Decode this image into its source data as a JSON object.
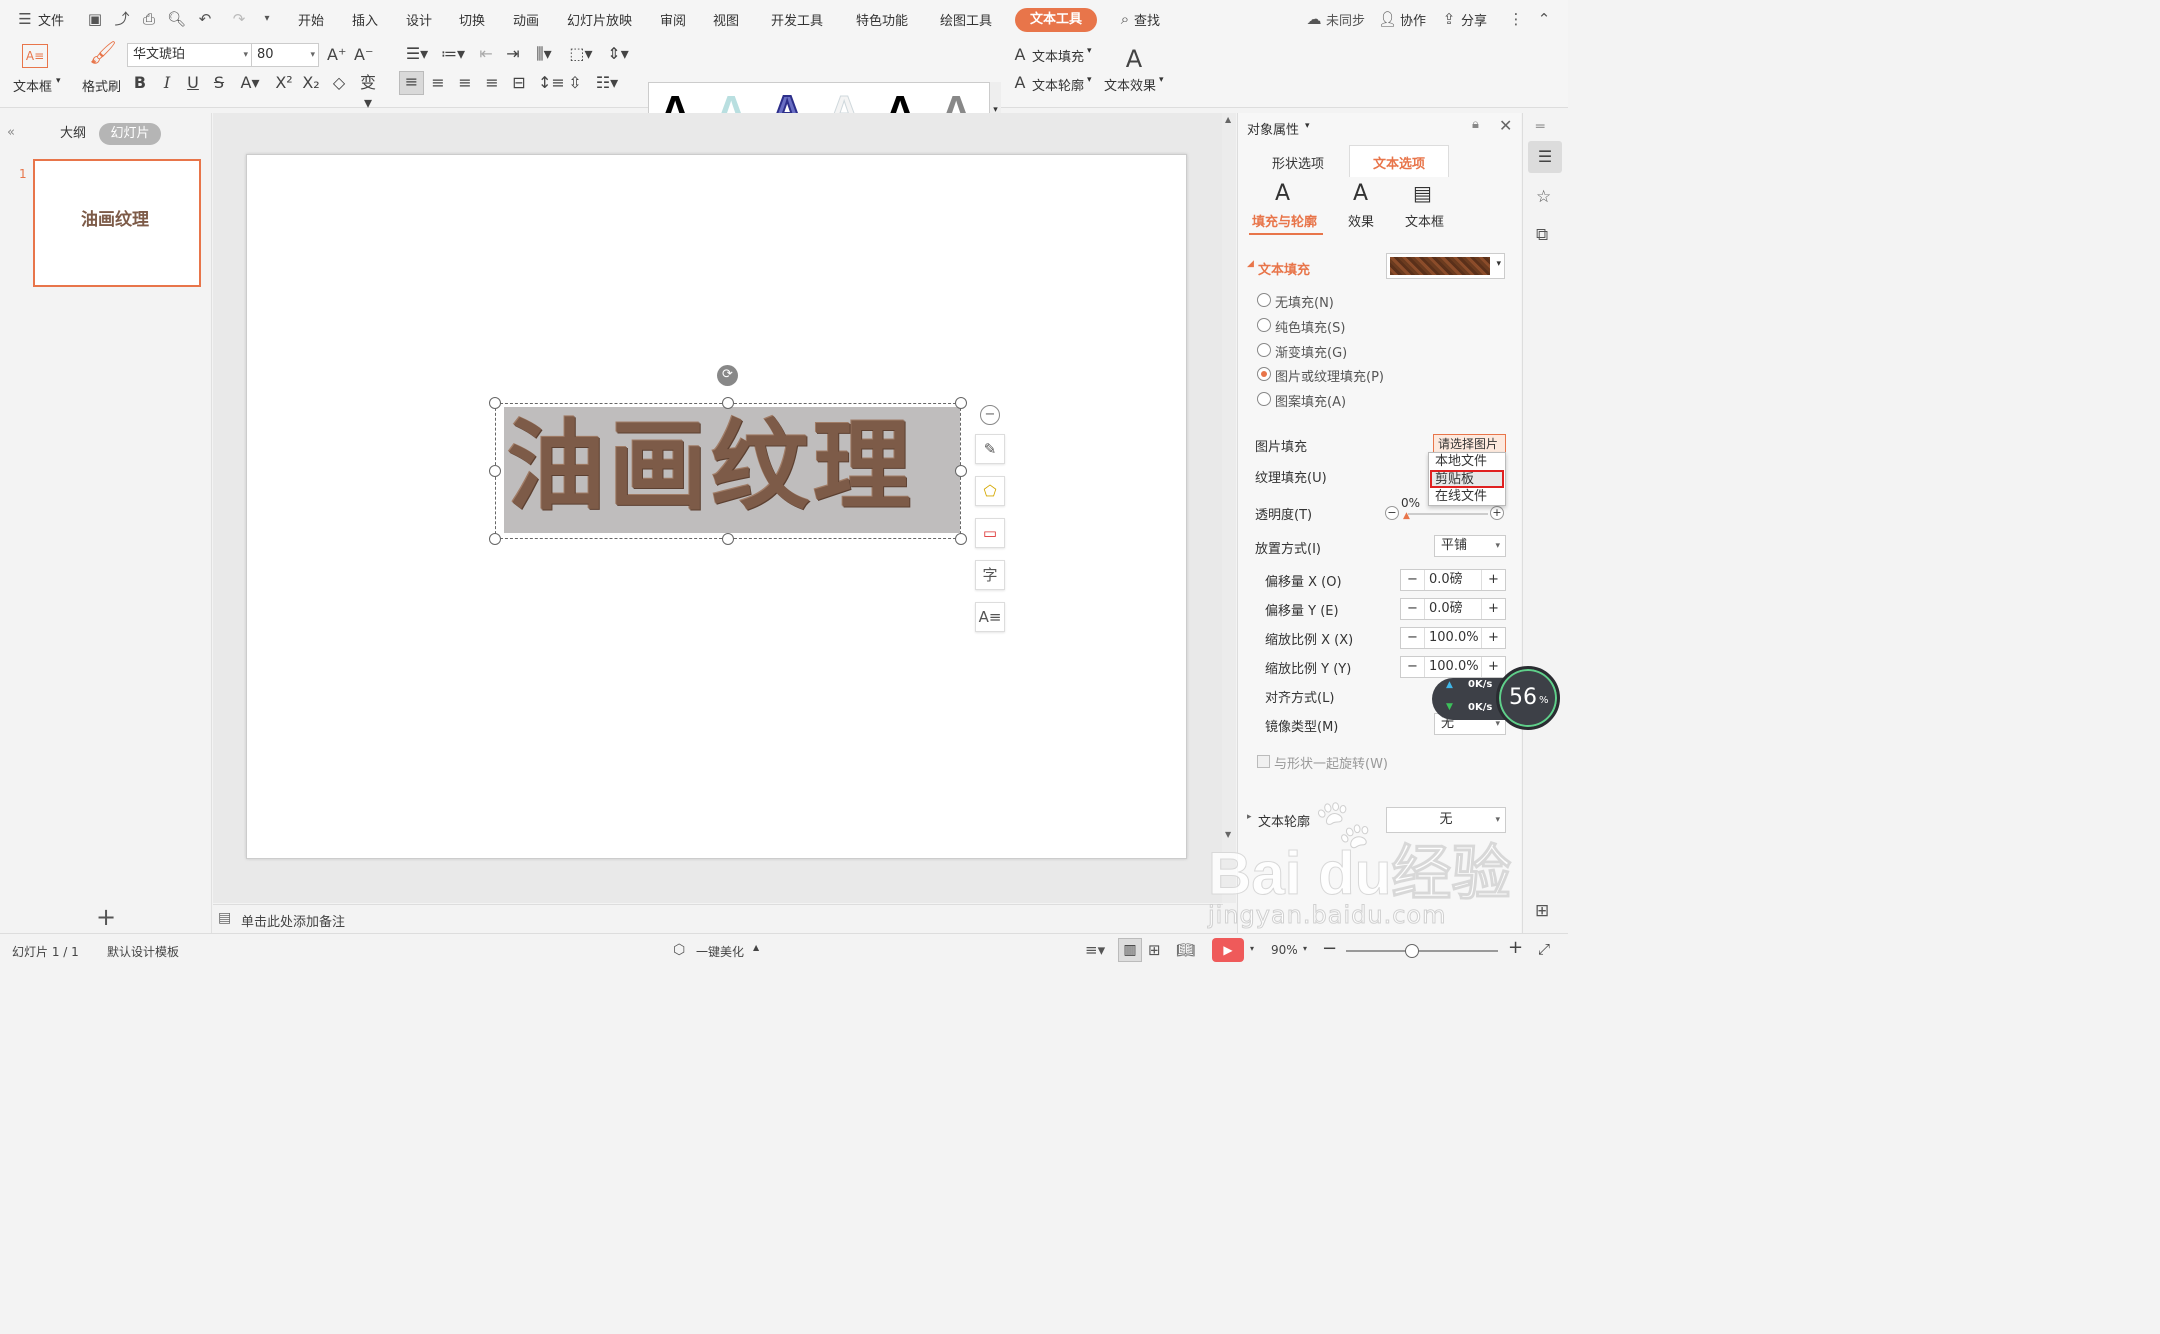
{
  "menubar": {
    "file": "文件",
    "tabs": [
      "开始",
      "插入",
      "设计",
      "切换",
      "动画",
      "幻灯片放映",
      "审阅",
      "视图",
      "开发工具",
      "特色功能",
      "绘图工具"
    ],
    "active_tab": "文本工具",
    "search": "查找",
    "sync": "未同步",
    "collab": "协作",
    "share": "分享"
  },
  "ribbon": {
    "textbox": "文本框",
    "format_painter": "格式刷",
    "font_name": "华文琥珀",
    "font_size": "80",
    "bold": "B",
    "italic": "I",
    "underline": "U",
    "strike": "S",
    "text_fill": "文本填充",
    "text_outline": "文本轮廓",
    "text_effect": "文本效果",
    "gallery": [
      "A",
      "A",
      "A",
      "A",
      "A",
      "A"
    ]
  },
  "leftpanel": {
    "outline_tab": "大纲",
    "slides_tab": "幻灯片",
    "slide_number": "1",
    "thumb_text": "油画纹理"
  },
  "slide": {
    "text": "油画纹理"
  },
  "notes": {
    "placeholder": "单击此处添加备注"
  },
  "statusbar": {
    "slide_count": "幻灯片 1 / 1",
    "template": "默认设计模板",
    "beautify": "一键美化",
    "zoom": "90%"
  },
  "rightpanel": {
    "title": "对象属性",
    "tab_shape": "形状选项",
    "tab_text": "文本选项",
    "sub_fill": "填充与轮廓",
    "sub_effect": "效果",
    "sub_textbox": "文本框",
    "section_fill": "文本填充",
    "radios": [
      "无填充(N)",
      "纯色填充(S)",
      "渐变填充(G)",
      "图片或纹理填充(P)",
      "图案填充(A)"
    ],
    "selected_radio": 3,
    "picture_fill_label": "图片填充",
    "picture_fill_value": "请选择图片",
    "texture_fill_label": "纹理填充(U)",
    "transparency_label": "透明度(T)",
    "transparency_value": "0%",
    "placement_label": "放置方式(I)",
    "placement_value": "平铺",
    "offset_x_label": "偏移量 X (O)",
    "offset_x_value": "0.0磅",
    "offset_y_label": "偏移量 Y (E)",
    "offset_y_value": "0.0磅",
    "scale_x_label": "缩放比例 X (X)",
    "scale_x_value": "100.0%",
    "scale_y_label": "缩放比例 Y (Y)",
    "scale_y_value": "100.0%",
    "align_label": "对齐方式(L)",
    "mirror_label": "镜像类型(M)",
    "mirror_value": "无",
    "rotate_with_shape": "与形状一起旋转(W)",
    "section_outline": "文本轮廓",
    "outline_value": "无",
    "dropdown": [
      "本地文件",
      "剪贴板",
      "在线文件"
    ]
  },
  "speed": {
    "up": "0K/s",
    "down": "0K/s",
    "percent": "56",
    "percent_unit": "%"
  },
  "watermark": {
    "brand": "Bai  du经验",
    "url": "jingyan.baidu.com"
  },
  "colors": {
    "accent": "#e8754a",
    "text_texture": "#7d5b48",
    "dropdown_highlight": "#e02020"
  }
}
